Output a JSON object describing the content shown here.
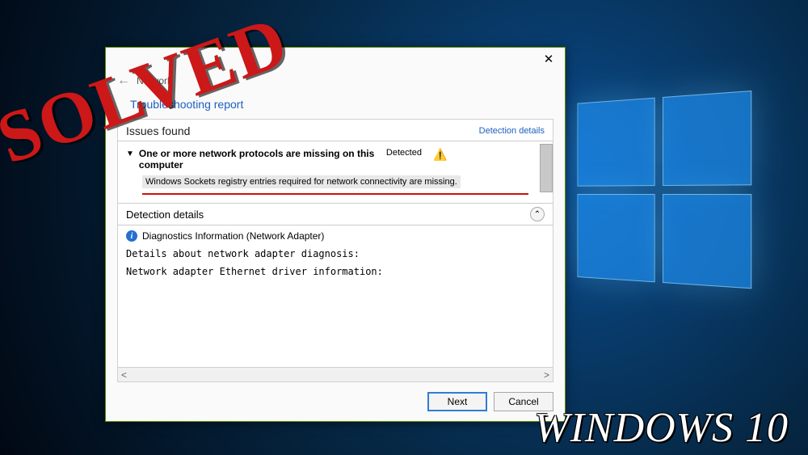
{
  "nav": {
    "crumb": "Network"
  },
  "title_link": "Troubleshooting report",
  "sections": {
    "issues": {
      "heading": "Issues found",
      "detection_link": "Detection details"
    }
  },
  "issue": {
    "title": "One or more network protocols are missing on this computer",
    "status": "Detected",
    "description": "Windows Sockets registry entries required for network connectivity are missing."
  },
  "detection": {
    "heading": "Detection details",
    "diag_label": "Diagnostics Information (Network Adapter)",
    "line1": "Details about network adapter diagnosis:",
    "line2": "Network adapter Ethernet driver information:"
  },
  "buttons": {
    "next": "Next",
    "cancel": "Cancel"
  },
  "overlay": {
    "solved": "SOLVED",
    "windows10": "WINDOWS 10"
  }
}
